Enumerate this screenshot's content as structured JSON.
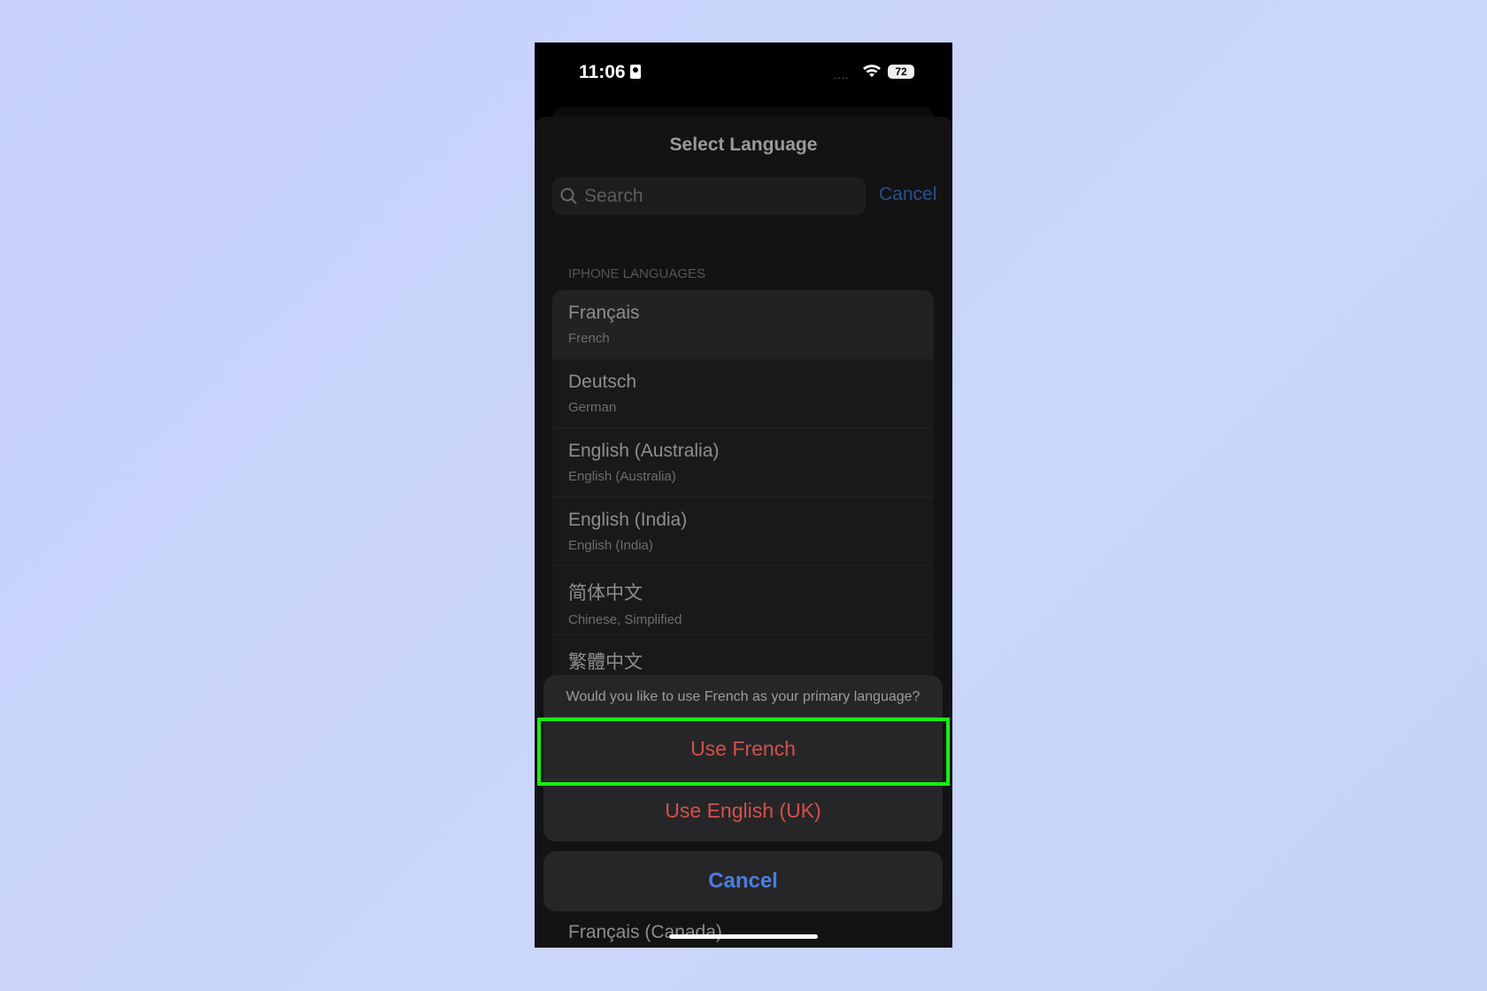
{
  "status_bar": {
    "time": "11:06",
    "signal_dots": "....",
    "battery": "72"
  },
  "sheet": {
    "title": "Select Language",
    "search_placeholder": "Search",
    "cancel": "Cancel"
  },
  "section_header": "IPHONE LANGUAGES",
  "languages": [
    {
      "name": "Français",
      "subtitle": "French"
    },
    {
      "name": "Deutsch",
      "subtitle": "German"
    },
    {
      "name": "English (Australia)",
      "subtitle": "English (Australia)"
    },
    {
      "name": "English (India)",
      "subtitle": "English (India)"
    },
    {
      "name": "简体中文",
      "subtitle": "Chinese, Simplified"
    },
    {
      "name": "繁體中文",
      "subtitle": ""
    }
  ],
  "below_item": "Français (Canada)",
  "action_sheet": {
    "message": "Would you like to use French as your primary language?",
    "option1": "Use French",
    "option2": "Use English (UK)",
    "cancel": "Cancel"
  },
  "colors": {
    "destructive": "#d4504a",
    "accent": "#4a7ee0",
    "highlight": "#16f013",
    "background": "#c9d3fb"
  }
}
